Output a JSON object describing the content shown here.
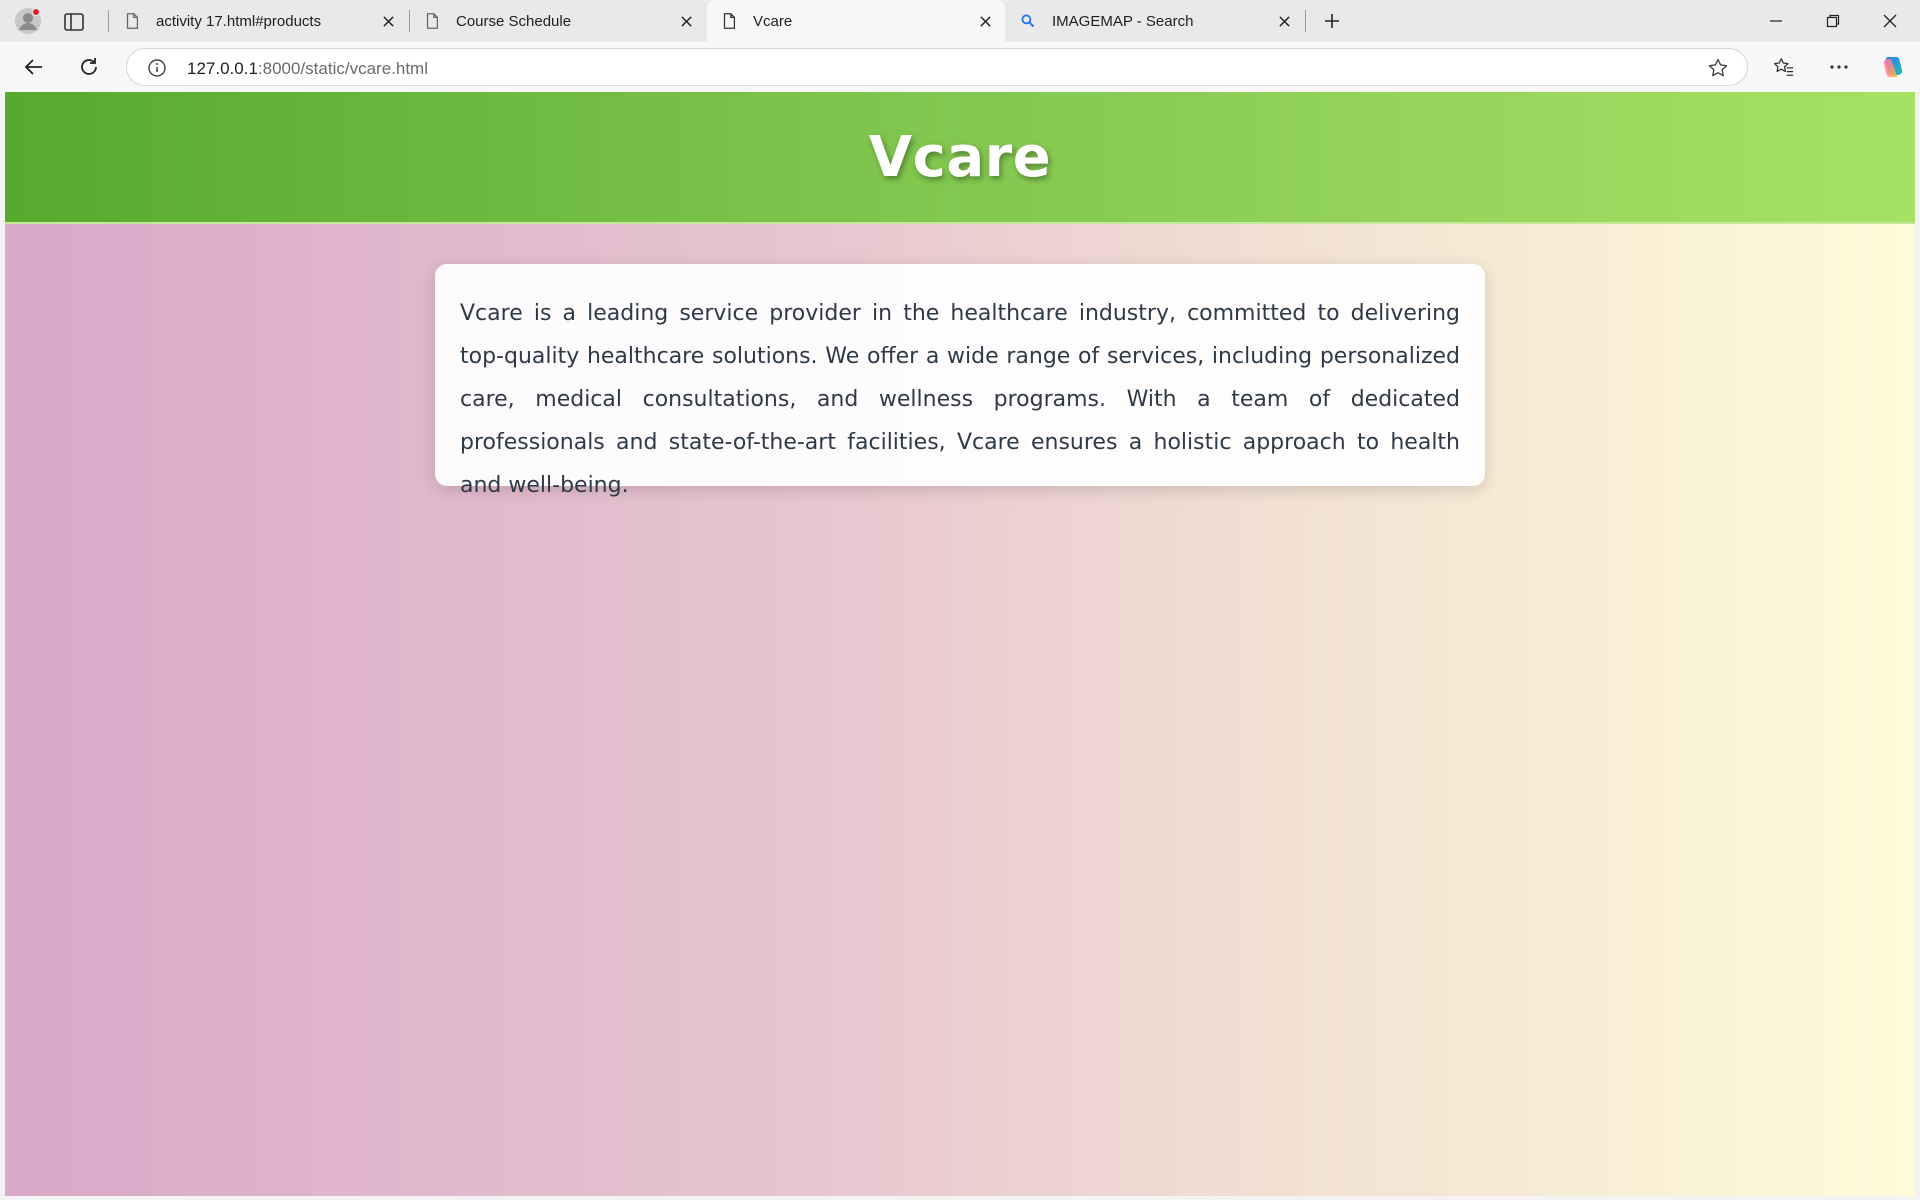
{
  "browser": {
    "tabs": [
      {
        "title": "activity 17.html#products",
        "active": false,
        "icon": "page-icon"
      },
      {
        "title": "Course Schedule",
        "active": false,
        "icon": "page-icon"
      },
      {
        "title": "Vcare",
        "active": true,
        "icon": "page-icon"
      },
      {
        "title": "IMAGEMAP - Search",
        "active": false,
        "icon": "search-icon"
      }
    ],
    "url_host": "127.0.0.1",
    "url_rest": ":8000/static/vcare.html",
    "accent_color": "#1a73e8"
  },
  "page": {
    "title": "Vcare",
    "description": "Vcare is a leading service provider in the healthcare industry, committed to delivering top-quality healthcare solutions. We offer a wide range of services, including personalized care, medical consultations, and wellness programs. With a team of dedicated professionals and state-of-the-art facilities, Vcare ensures a holistic approach to health and well-being.",
    "header_gradient": [
      "#56aa2e",
      "#a5e263"
    ],
    "body_gradient": [
      "#daa8c9",
      "#fffbd8"
    ]
  }
}
